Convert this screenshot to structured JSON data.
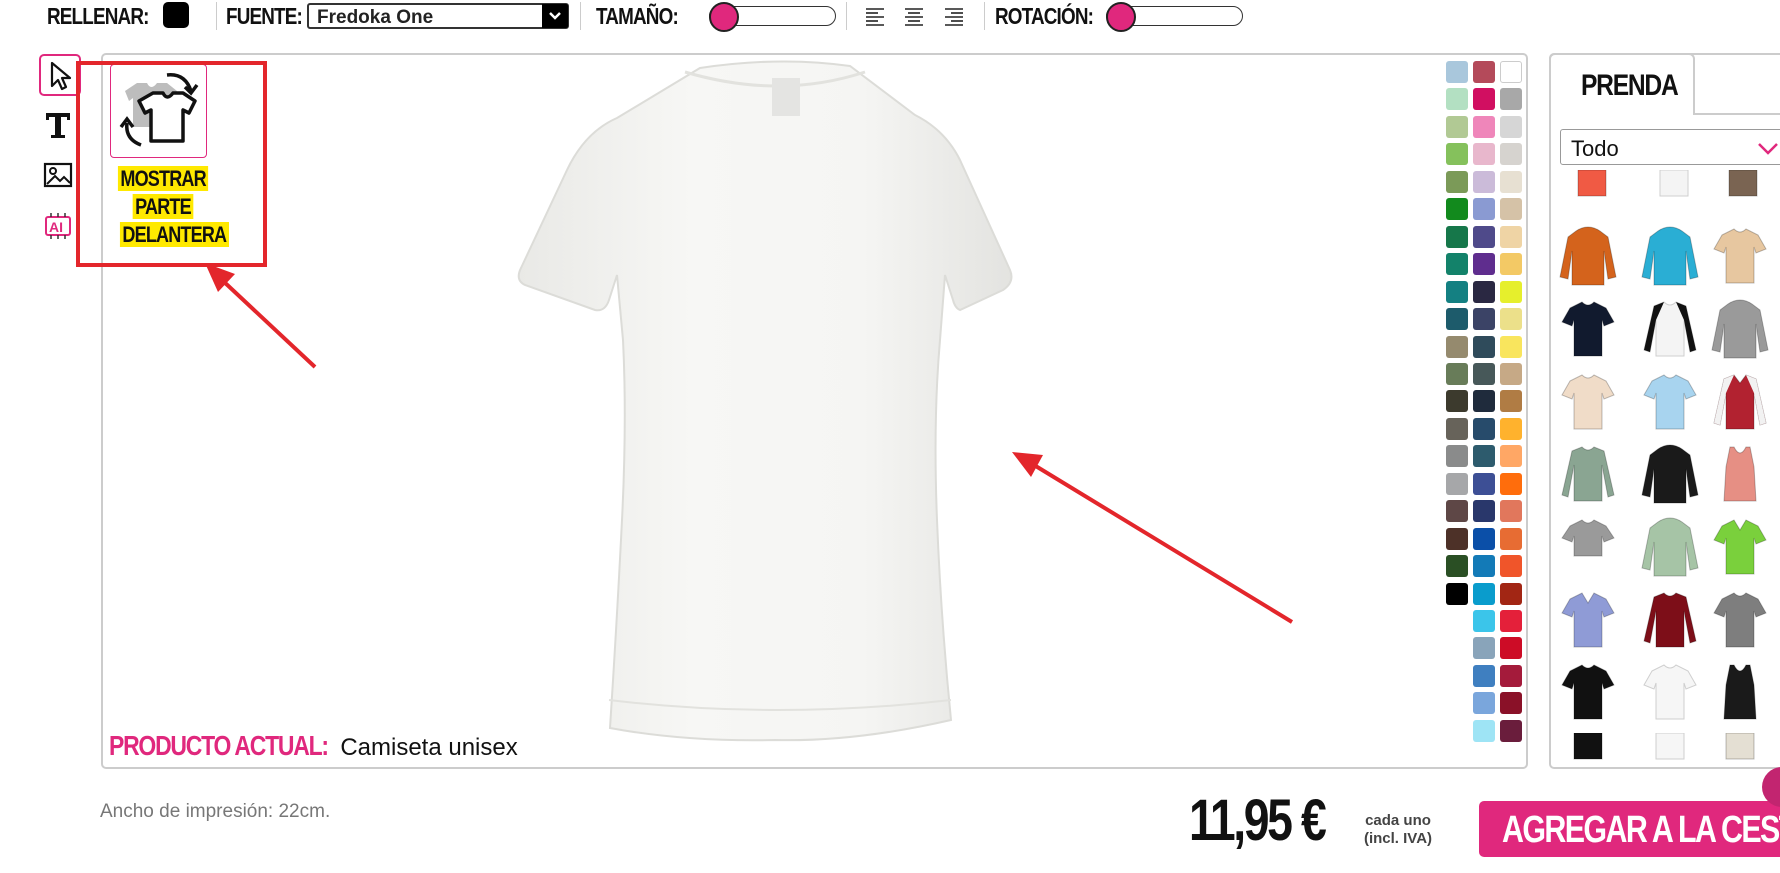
{
  "toolbar": {
    "fill_label": "RELLENAR:",
    "fill_color": "#000000",
    "font_label": "FUENTE:",
    "font_value": "Fredoka One",
    "size_label": "TAMAÑO:",
    "size_level": 0,
    "rotation_label": "ROTACIÓN:",
    "rotation_level": 0
  },
  "tools": [
    "cursor-icon",
    "text-icon",
    "image-icon",
    "ai-icon"
  ],
  "view_toggle": {
    "label_line1": "MOSTRAR",
    "label_line2": "PARTE",
    "label_line3": "DELANTERA"
  },
  "current_product": {
    "label": "PRODUCTO ACTUAL:",
    "value": "Camiseta unisex"
  },
  "colors": {
    "col1": [
      "#a9c7dc",
      "#b3e0c2",
      "#b1c994",
      "#85c15c",
      "#7b9a58",
      "#128a1d",
      "#16774a",
      "#13826a",
      "#148082",
      "#1d5b6b",
      "#958a6e",
      "#687c59",
      "#3c3a2d",
      "#67635a",
      "#8a8b8b",
      "#a6a7a9",
      "#5e4746",
      "#4d3128",
      "#2a4f24",
      "#000000"
    ],
    "col2": [
      "#b44a5a",
      "#d10f61",
      "#ef86ba",
      "#e8b7cc",
      "#cbbbd9",
      "#8a9ad2",
      "#4f4a8a",
      "#5f2d8e",
      "#2a2842",
      "#3b4366",
      "#2f4b5b",
      "#475859",
      "#1f2b3c",
      "#274b6b",
      "#2d5b6d",
      "#3d4f95",
      "#29376b",
      "#0b4fa8",
      "#137ab7",
      "#0a9ccc",
      "#3bc5ea",
      "#89a4ba",
      "#3f7fc0",
      "#7aa6dc",
      "#9ee4f5"
    ],
    "col3": [
      "#ffffff",
      "#a8a8a8",
      "#d6d6d6",
      "#d6d3cf",
      "#e7e0d2",
      "#d5c2a7",
      "#efd4a5",
      "#f3c965",
      "#e6ef2c",
      "#ece08a",
      "#f9e55d",
      "#c6a986",
      "#b07c44",
      "#ffb22d",
      "#ffa765",
      "#ff6d0c",
      "#e1775c",
      "#e76c33",
      "#f0552a",
      "#a22614",
      "#e4203a",
      "#cd0c26",
      "#a41b3b",
      "#8a1128",
      "#6a1d3c"
    ]
  },
  "panel": {
    "tab_label": "PRENDA",
    "category_value": "Todo"
  },
  "footer": {
    "print_width": "Ancho de impresión: 22cm.",
    "price": "11,95 €",
    "each_line1": "cada uno",
    "each_line2": "(incl. IVA)",
    "add_to_cart": "AGREGAR A LA CESTA"
  },
  "accent_color": "#e0287d",
  "annotation_color": "#e3262b"
}
